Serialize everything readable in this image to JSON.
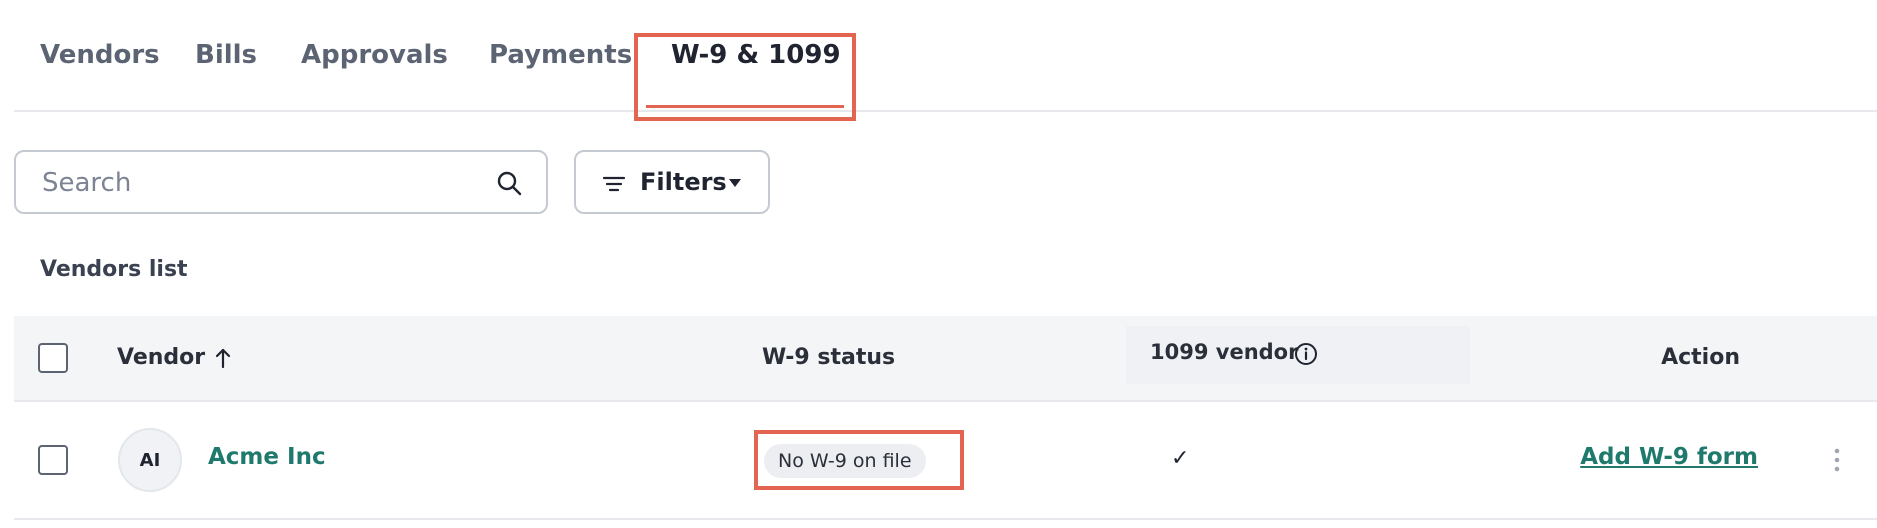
{
  "tabs": [
    {
      "label": "Vendors"
    },
    {
      "label": "Bills"
    },
    {
      "label": "Approvals"
    },
    {
      "label": "Payments"
    },
    {
      "label": "W-9 & 1099",
      "active": true
    }
  ],
  "search": {
    "placeholder": "Search",
    "value": ""
  },
  "filters": {
    "label": "Filters"
  },
  "list": {
    "title": "Vendors list"
  },
  "table": {
    "columns": {
      "vendor": "Vendor",
      "w9_status": "W-9 status",
      "vendor_1099": "1099 vendor",
      "action": "Action"
    },
    "rows": [
      {
        "initials": "AI",
        "vendor": "Acme Inc",
        "w9_status": "No W-9 on file",
        "is_1099": "✓",
        "action": "Add W-9 form"
      }
    ]
  },
  "colors": {
    "accent": "#e36450",
    "link": "#1f7a6d"
  },
  "icons": [
    "search-icon",
    "filter-lines-icon",
    "chevron-down-icon",
    "sort-ascending-icon",
    "info-icon",
    "kebab-menu-icon"
  ]
}
